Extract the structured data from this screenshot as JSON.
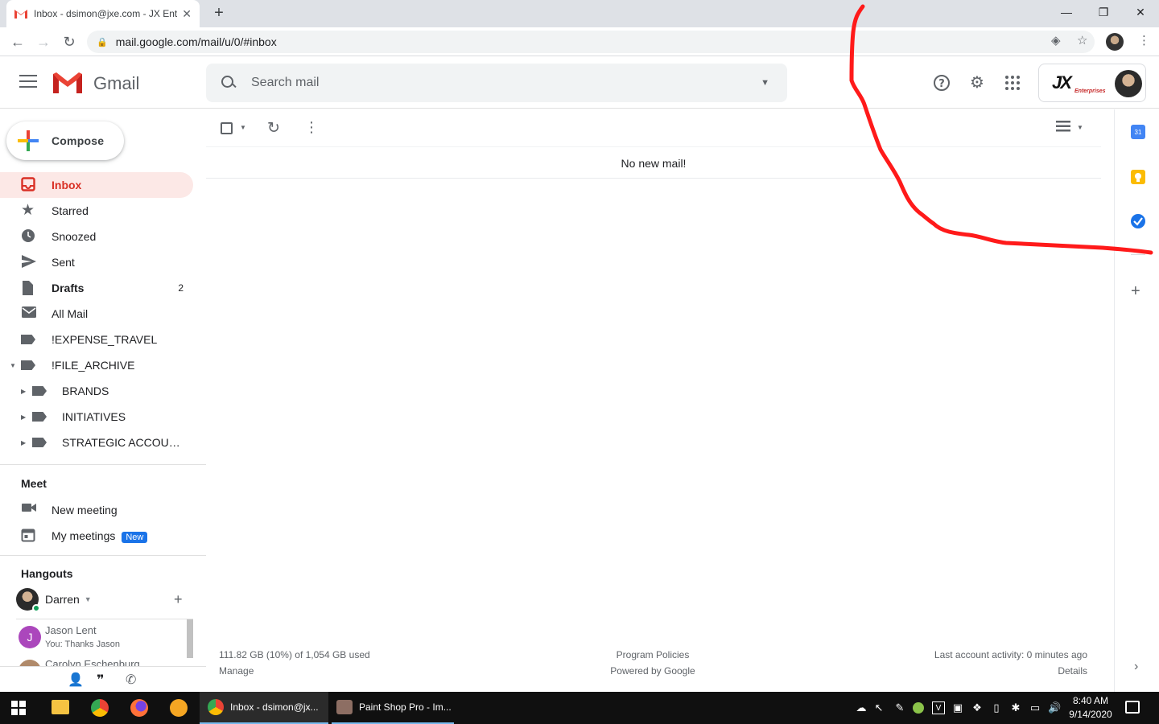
{
  "browser": {
    "tab_title": "Inbox - dsimon@jxe.com - JX Enterprises Mail",
    "url": "mail.google.com/mail/u/0/#inbox"
  },
  "gmail": {
    "app_name": "Gmail",
    "search_placeholder": "Search mail",
    "compose_label": "Compose",
    "nav": [
      {
        "label": "Inbox",
        "count": ""
      },
      {
        "label": "Starred",
        "count": ""
      },
      {
        "label": "Snoozed",
        "count": ""
      },
      {
        "label": "Sent",
        "count": ""
      },
      {
        "label": "Drafts",
        "count": "2"
      },
      {
        "label": "All Mail",
        "count": ""
      },
      {
        "label": "!EXPENSE_TRAVEL",
        "count": ""
      },
      {
        "label": "!FILE_ARCHIVE",
        "count": ""
      },
      {
        "label": "BRANDS",
        "count": ""
      },
      {
        "label": "INITIATIVES",
        "count": ""
      },
      {
        "label": "STRATEGIC ACCOUNTS",
        "count": ""
      }
    ],
    "meet": {
      "title": "Meet",
      "new_meeting": "New meeting",
      "my_meetings": "My meetings",
      "new_badge": "New"
    },
    "hangouts": {
      "title": "Hangouts",
      "user": "Darren",
      "contacts": [
        {
          "name": "Jason Lent",
          "initial": "J",
          "snippet": "You: Thanks Jason"
        },
        {
          "name": "Carolyn Eschenburg",
          "initial": "",
          "snippet": ""
        }
      ]
    },
    "account_logo": "JX",
    "account_logo_sub": "Enterprises",
    "empty_message": "No new mail!",
    "footer": {
      "storage": "111.82 GB (10%) of 1,054 GB used",
      "manage": "Manage",
      "policies": "Program Policies",
      "powered": "Powered by Google",
      "activity": "Last account activity: 0 minutes ago",
      "details": "Details"
    }
  },
  "taskbar": {
    "app1": "Inbox - dsimon@jx...",
    "app2": "Paint Shop Pro - Im...",
    "time": "8:40 AM",
    "date": "9/14/2020"
  },
  "colors": {
    "inbox_active_bg": "#fce8e6",
    "inbox_active_text": "#d93025",
    "annotation_stroke": "#ff1a1a"
  }
}
